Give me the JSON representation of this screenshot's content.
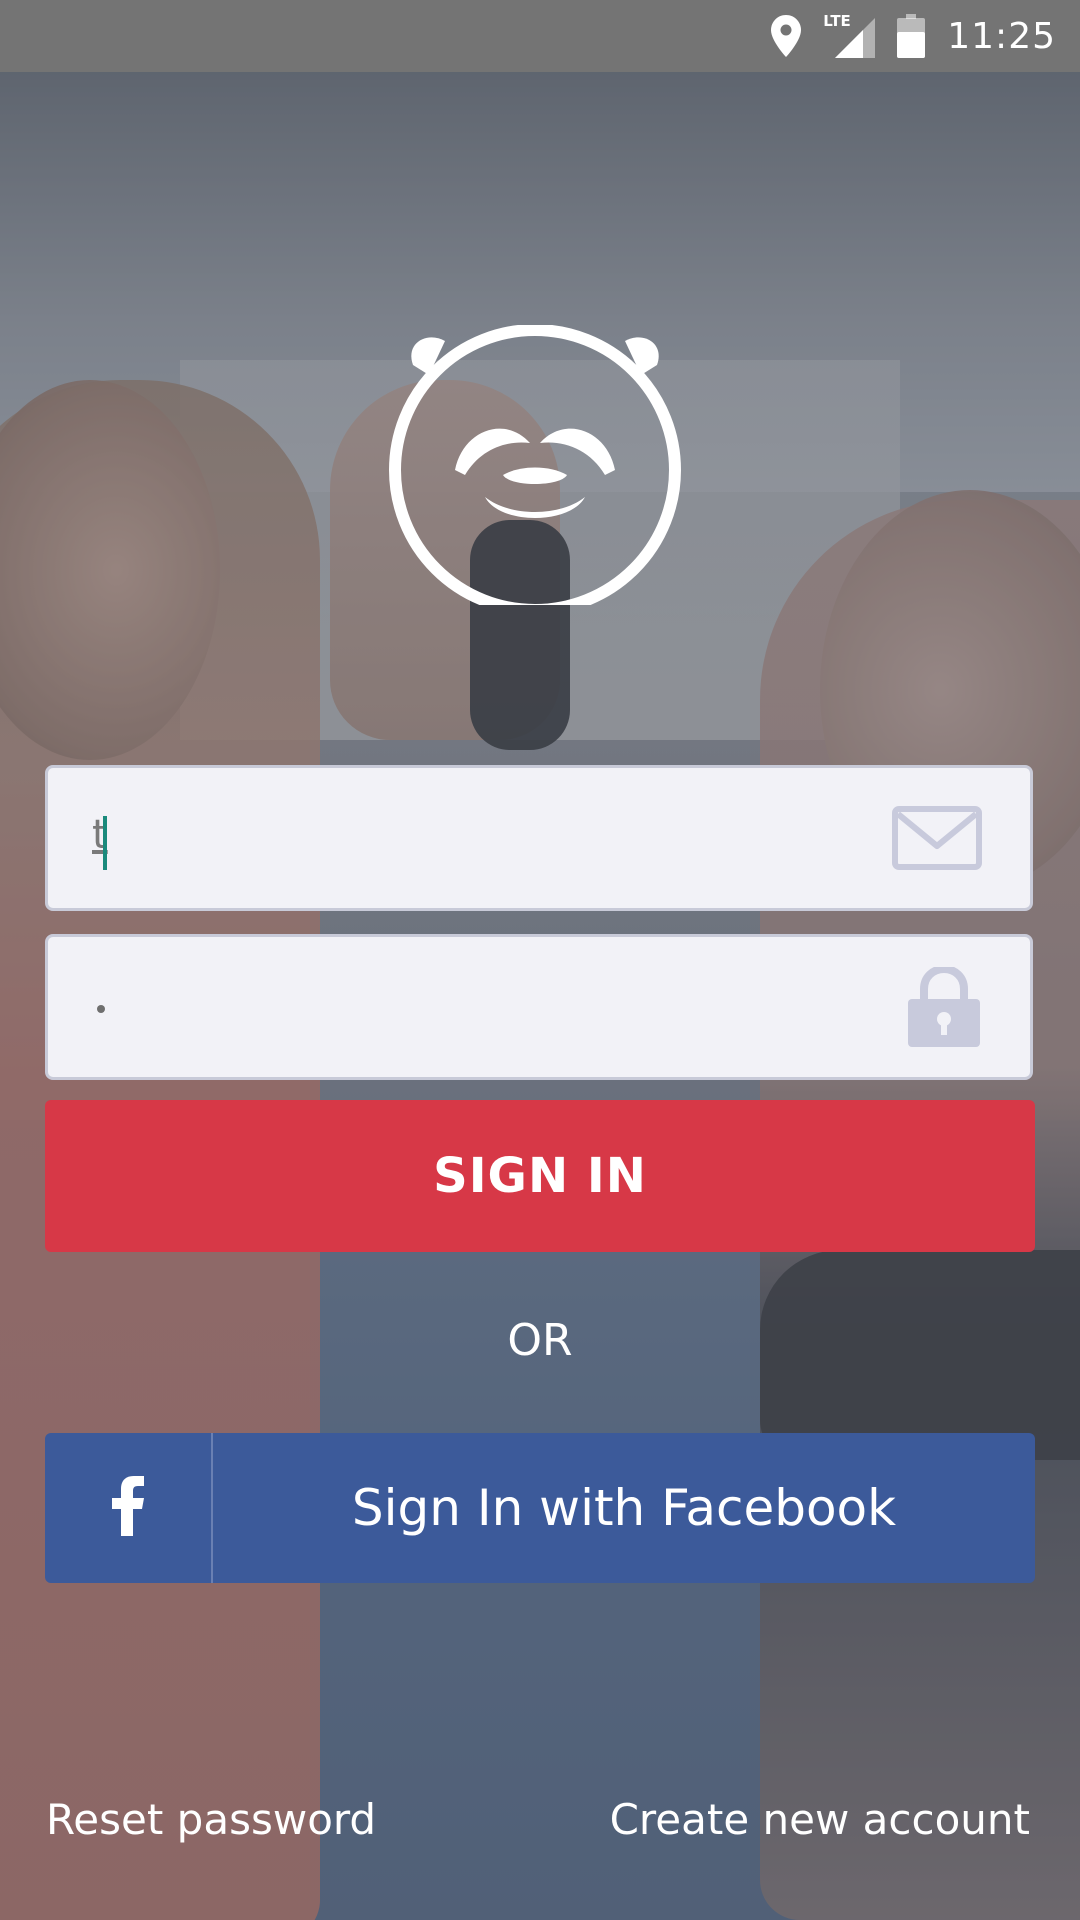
{
  "status_bar": {
    "network_label": "LTE",
    "time": "11:25",
    "icons": [
      "location-icon",
      "signal-icon",
      "battery-icon"
    ]
  },
  "logo": {
    "icon": "panda-logo-icon"
  },
  "login_form": {
    "email": {
      "value": "t",
      "icon": "mail-icon"
    },
    "password": {
      "icon": "lock-icon"
    },
    "sign_in_label": "SIGN IN",
    "or_label": "OR",
    "facebook_label": "Sign In with Facebook",
    "facebook_icon": "facebook-icon"
  },
  "footer": {
    "reset_password": "Reset password",
    "create_account": "Create new account"
  },
  "colors": {
    "primary_red": "#d73847",
    "facebook_blue": "#3c5a9a",
    "field_bg": "#f2f2f7",
    "field_icon": "#c8cadc",
    "caret": "#1a8a7c"
  }
}
